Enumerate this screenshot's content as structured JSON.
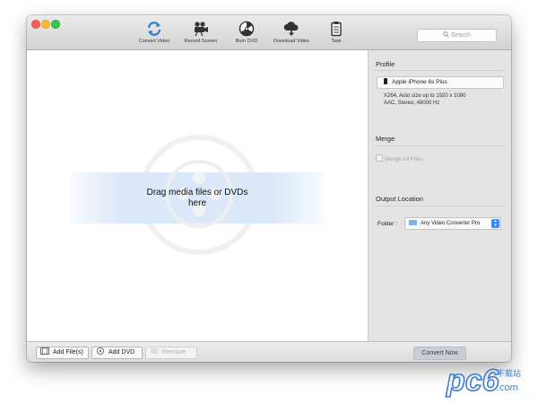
{
  "toolbar": {
    "items": [
      {
        "label": "Convert Video",
        "icon": "convert-video-icon"
      },
      {
        "label": "Record Screen",
        "icon": "record-screen-icon"
      },
      {
        "label": "Burn DVD",
        "icon": "burn-dvd-icon"
      },
      {
        "label": "Download Video",
        "icon": "download-video-icon"
      },
      {
        "label": "Task",
        "icon": "task-icon"
      }
    ],
    "search_placeholder": "Search"
  },
  "dropzone": {
    "line1": "Drag media files or DVDs",
    "line2": "here"
  },
  "sidebar": {
    "profile": {
      "title": "Profile",
      "device": "Apple iPhone 6s Plus",
      "info_line1": "X264, Auto size up to 1920 x 1080",
      "info_line2": "AAC, Stereo, 48000 Hz"
    },
    "merge": {
      "title": "Merge",
      "checkbox_label": "Merge All Files",
      "checked": false
    },
    "output": {
      "title": "Output Location",
      "folder_label": "Folder :",
      "folder_value": "Any Video Converter Pro"
    }
  },
  "bottombar": {
    "add_files": "Add File(s)",
    "add_dvd": "Add DVD",
    "remove": "Remove",
    "convert": "Convert Now"
  },
  "watermark": {
    "brand": "pc6",
    "small_text": "下载站",
    "domain": ".com"
  },
  "colors": {
    "accent_blue": "#3b8af7",
    "convert_icon_blue": "#2f7fd8",
    "drop_band": "#dbe8f9",
    "watermark_blue": "#3d7fcf"
  }
}
